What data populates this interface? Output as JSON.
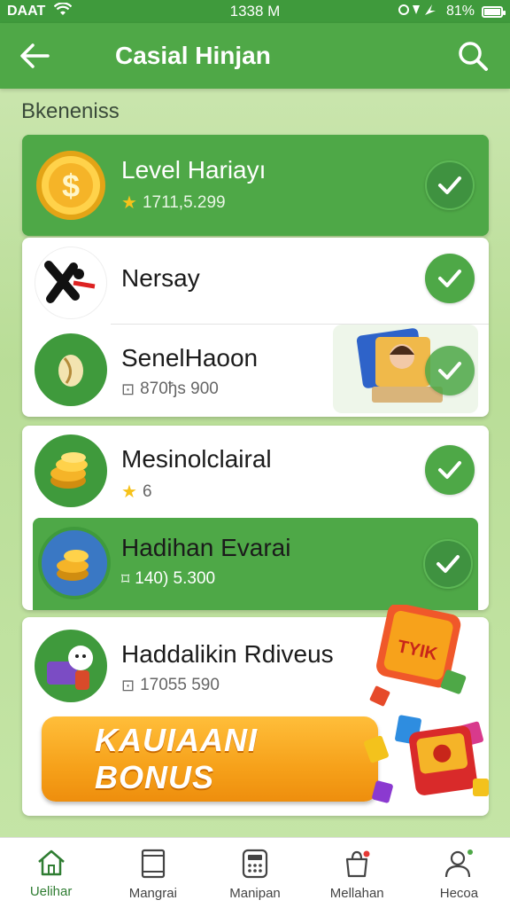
{
  "status_bar": {
    "carrier": "DAAT",
    "time": "1338 M",
    "battery": "81%",
    "battery_level": 0.81
  },
  "header": {
    "title": "Casial Hinjan"
  },
  "section_title": "Bkeneniss",
  "items": [
    {
      "name": "Level Hariayı",
      "sub": "1711,5.299",
      "sub_icon": "star-icon",
      "highlight": true,
      "checked": true
    },
    {
      "name": "Nersay",
      "sub": "",
      "highlight": false,
      "checked": true
    },
    {
      "name": "SenelHaoon",
      "sub": "870ђs 900",
      "sub_icon": "gift-icon",
      "highlight": false,
      "checked": true
    },
    {
      "name": "Mesinolclairal",
      "sub": "6",
      "sub_icon": "star-icon",
      "highlight": false,
      "checked": true
    },
    {
      "name": "Hadihan Evarai",
      "sub": "140) 5.300",
      "sub_icon": "tag-icon",
      "highlight": true,
      "checked": true
    },
    {
      "name": "Haddalikin Rdiveus",
      "sub": "17055 590",
      "sub_icon": "gift-icon",
      "highlight": false,
      "checked": false
    }
  ],
  "bonus_button": {
    "label": "KAUIAANI BONUS"
  },
  "bottom_nav": [
    {
      "label": "Uelihar",
      "icon": "home-icon",
      "active": true
    },
    {
      "label": "Mangrai",
      "icon": "tablet-icon",
      "active": false
    },
    {
      "label": "Manipan",
      "icon": "calculator-icon",
      "active": false
    },
    {
      "label": "Mellahan",
      "icon": "bag-icon",
      "active": false
    },
    {
      "label": "Hecoa",
      "icon": "person-icon",
      "active": false
    }
  ],
  "colors": {
    "primary": "#4fa847",
    "accent_orange": "#f6a11a",
    "background": "#c6e6a8"
  }
}
